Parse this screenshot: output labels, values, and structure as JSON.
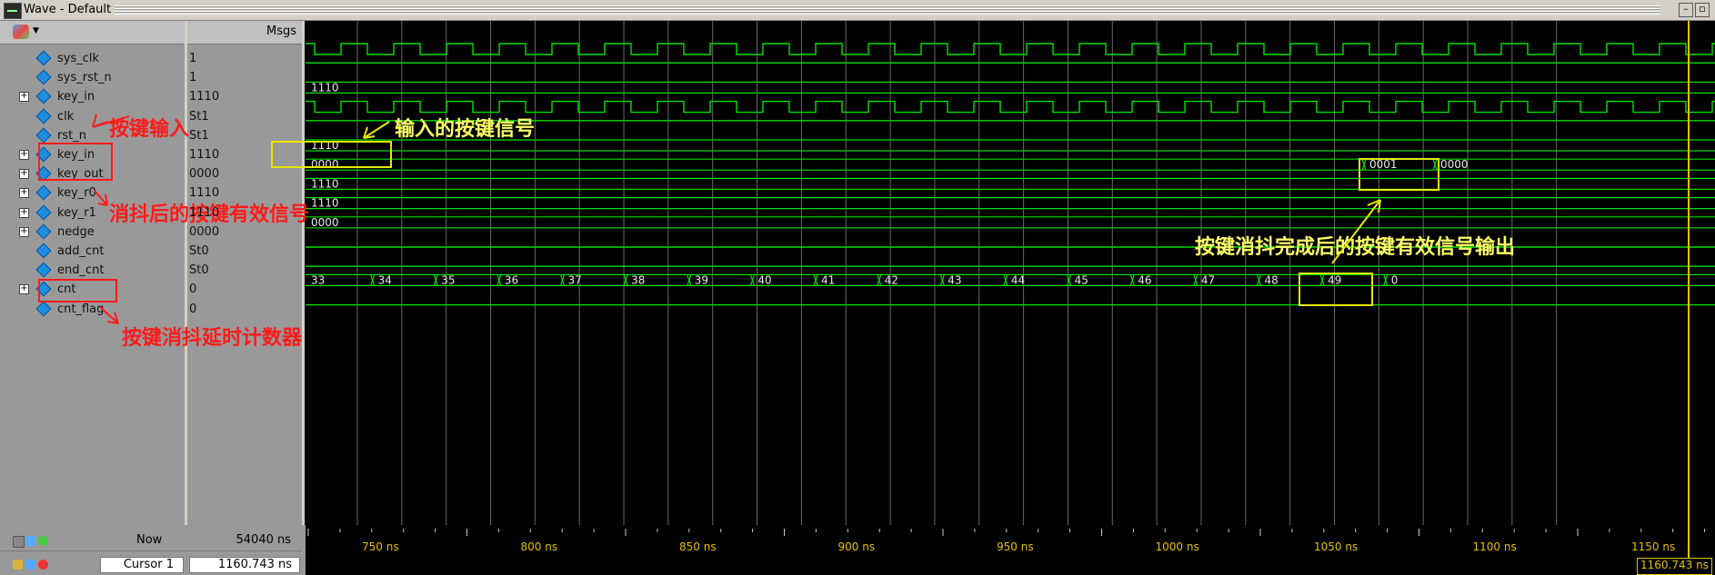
{
  "window": {
    "title": "Wave - Default"
  },
  "header": {
    "msgs_label": "Msgs"
  },
  "signals": [
    {
      "name": "sys_clk",
      "value": "1",
      "expandable": false
    },
    {
      "name": "sys_rst_n",
      "value": "1",
      "expandable": false
    },
    {
      "name": "key_in",
      "value": "1110",
      "expandable": true
    },
    {
      "name": "clk",
      "value": "St1",
      "expandable": false
    },
    {
      "name": "rst_n",
      "value": "St1",
      "expandable": false
    },
    {
      "name": "key_in",
      "value": "1110",
      "expandable": true
    },
    {
      "name": "key_out",
      "value": "0000",
      "expandable": true
    },
    {
      "name": "key_r0",
      "value": "1110",
      "expandable": true
    },
    {
      "name": "key_r1",
      "value": "1110",
      "expandable": true
    },
    {
      "name": "nedge",
      "value": "0000",
      "expandable": true
    },
    {
      "name": "add_cnt",
      "value": "St0",
      "expandable": false
    },
    {
      "name": "end_cnt",
      "value": "St0",
      "expandable": false
    },
    {
      "name": "cnt",
      "value": "0",
      "expandable": true
    },
    {
      "name": "cnt_flag",
      "value": "0",
      "expandable": false
    }
  ],
  "bus_labels": {
    "key_in_top": "1110",
    "key_in": "1110",
    "key_out": [
      "0000",
      "0001",
      "0000"
    ],
    "key_r0": "1110",
    "key_r1": "1110",
    "nedge": "0000",
    "cnt": [
      "33",
      "34",
      "35",
      "36",
      "37",
      "38",
      "39",
      "40",
      "41",
      "42",
      "43",
      "44",
      "45",
      "46",
      "47",
      "48",
      "49",
      "0"
    ]
  },
  "timeline": {
    "ticks": [
      "750 ns",
      "800 ns",
      "850 ns",
      "900 ns",
      "950 ns",
      "1000 ns",
      "1050 ns",
      "1100 ns",
      "1150 ns"
    ],
    "cursor_time": "1160.743 ns"
  },
  "status": {
    "now_label": "Now",
    "now_value": "54040 ns",
    "cursor_label": "Cursor 1",
    "cursor_value": "1160.743 ns"
  },
  "annotations": {
    "key_input": "按键输入",
    "input_key_signal": "输入的按键信号",
    "debounced_valid": "消抖后的按键有效信号",
    "debounce_done_output": "按键消抖完成后的按键有效信号输出",
    "delay_counter": "按键消抖延时计数器"
  },
  "colors": {
    "wave": "#00e000",
    "grid": "#6a6a6a",
    "cursor": "#e8c000",
    "annotation_red": "#ff1a1a",
    "annotation_yellow": "#ffff66"
  }
}
